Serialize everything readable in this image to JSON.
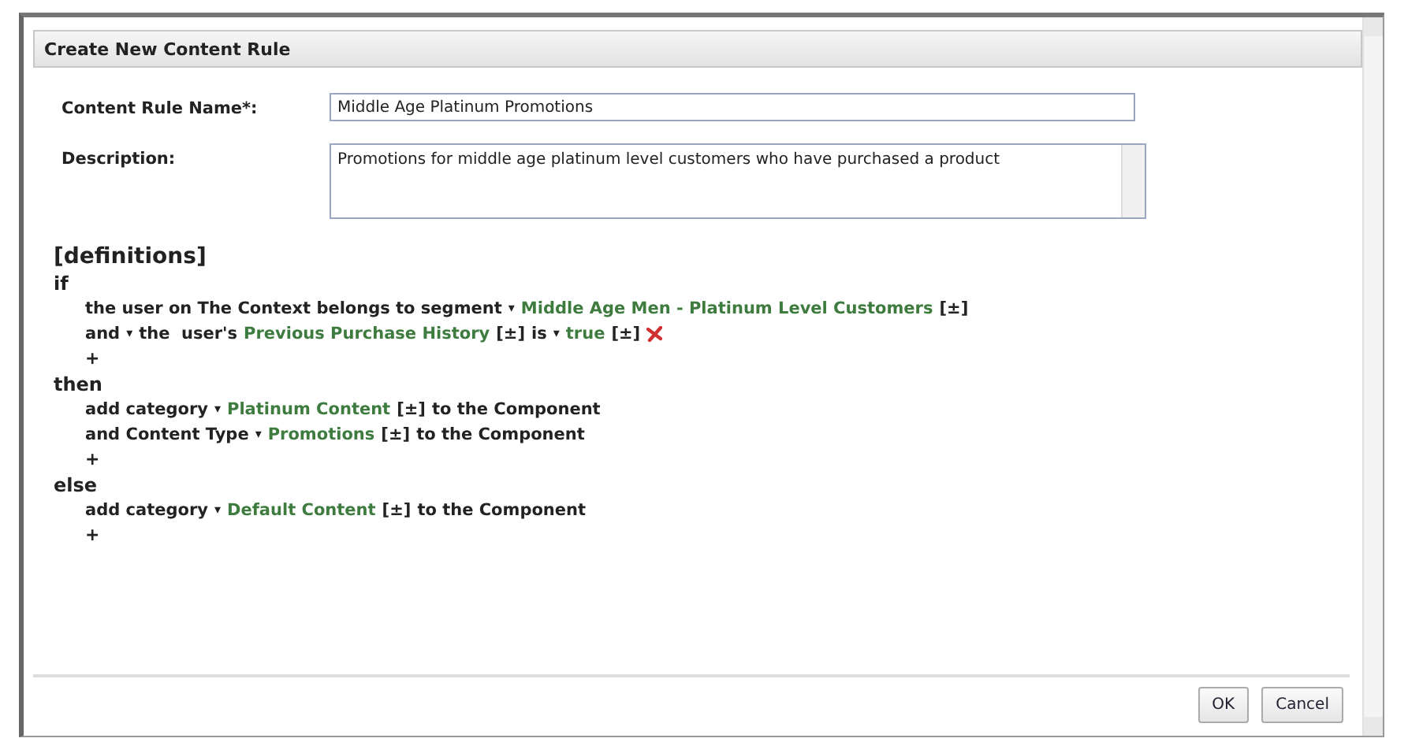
{
  "dialog": {
    "title": "Create New Content Rule"
  },
  "fields": [
    {
      "kind": "input",
      "label": "Content Rule Name*:",
      "value": "Middle Age Platinum Promotions"
    },
    {
      "kind": "textarea",
      "label": "Description:",
      "value": "Promotions for middle age platinum level customers who have purchased a product"
    }
  ],
  "rule": {
    "header": "[definitions]",
    "blocks": [
      {
        "keyword": "if",
        "lines": [
          [
            {
              "kind": "text",
              "text": "the user on The Context belongs to segment"
            },
            {
              "kind": "dropdown",
              "text": "▾"
            },
            {
              "kind": "value",
              "text": "Middle Age Men - Platinum Level Customers"
            },
            {
              "kind": "toggle",
              "text": "[±]"
            }
          ],
          [
            {
              "kind": "text",
              "text": "and"
            },
            {
              "kind": "dropdown",
              "text": "▾"
            },
            {
              "kind": "text",
              "text": "the  user's"
            },
            {
              "kind": "value",
              "text": "Previous Purchase History"
            },
            {
              "kind": "toggle",
              "text": "[±]"
            },
            {
              "kind": "text",
              "text": "is"
            },
            {
              "kind": "dropdown",
              "text": "▾"
            },
            {
              "kind": "value",
              "text": "true"
            },
            {
              "kind": "toggle",
              "text": "[±]"
            },
            {
              "kind": "remove"
            }
          ]
        ],
        "add": "+"
      },
      {
        "keyword": "then",
        "lines": [
          [
            {
              "kind": "text",
              "text": "add category"
            },
            {
              "kind": "dropdown",
              "text": "▾"
            },
            {
              "kind": "value",
              "text": "Platinum Content"
            },
            {
              "kind": "toggle",
              "text": "[±]"
            },
            {
              "kind": "text",
              "text": "to the Component"
            }
          ],
          [
            {
              "kind": "text",
              "text": "and Content Type"
            },
            {
              "kind": "dropdown",
              "text": "▾"
            },
            {
              "kind": "value",
              "text": "Promotions"
            },
            {
              "kind": "toggle",
              "text": "[±]"
            },
            {
              "kind": "text",
              "text": "to the Component"
            }
          ]
        ],
        "add": "+"
      },
      {
        "keyword": "else",
        "lines": [
          [
            {
              "kind": "text",
              "text": "add category"
            },
            {
              "kind": "dropdown",
              "text": "▾"
            },
            {
              "kind": "value",
              "text": "Default Content"
            },
            {
              "kind": "toggle",
              "text": "[±]"
            },
            {
              "kind": "text",
              "text": "to the Component"
            }
          ]
        ],
        "add": "+"
      }
    ]
  },
  "buttons": [
    "OK",
    "Cancel"
  ]
}
